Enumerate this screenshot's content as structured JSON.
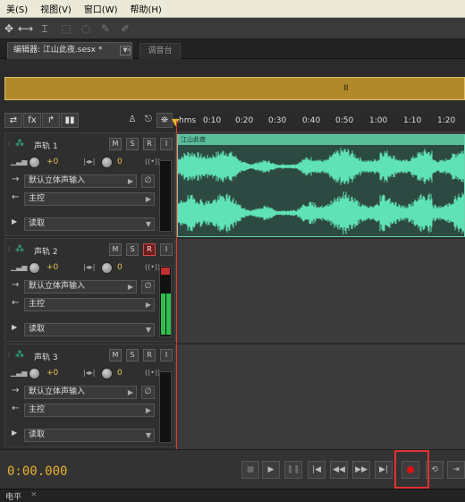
{
  "menu": [
    "美(S)",
    "视图(V)",
    "窗口(W)",
    "帮助(H)"
  ],
  "tools": [
    "move-tool",
    "time-selection-tool",
    "razor-tool",
    "marquee-tool",
    "lasso-tool",
    "brush-tool",
    "spot-healing-tool"
  ],
  "editor_tab": {
    "label": "编辑器: 江山此夜.sesx *",
    "dropdown": "▼",
    "close": "×"
  },
  "mixer_tab": {
    "label": "调音台"
  },
  "overview_handle": "III",
  "ruler": {
    "unit": "hms",
    "labels": [
      "0:10",
      "0:20",
      "0:30",
      "0:40",
      "0:50",
      "1:00",
      "1:10",
      "1:20"
    ]
  },
  "tracks": [
    {
      "name": "声轨 1",
      "volume": "+0",
      "pan": "0",
      "input": "默认立体声输入",
      "output": "主控",
      "automation": "读取",
      "record_armed": false,
      "clip": "江山此夜"
    },
    {
      "name": "声轨 2",
      "volume": "+0",
      "pan": "0",
      "input": "默认立体声输入",
      "output": "主控",
      "automation": "读取",
      "record_armed": true
    },
    {
      "name": "声轨 3",
      "volume": "+0",
      "pan": "0",
      "input": "默认立体声输入",
      "output": "主控",
      "automation": "读取",
      "record_armed": false
    }
  ],
  "track_buttons": {
    "mute": "M",
    "solo": "S",
    "record": "R",
    "input_monitor": "I"
  },
  "transport": {
    "timecode": "0:00.000"
  },
  "bottom_panel": {
    "label": "电平",
    "close": "×"
  },
  "colors": {
    "waveform": "#5fe3b6",
    "timecode": "#e8b22e",
    "record": "#dd1111",
    "highlight": "#e53030"
  }
}
